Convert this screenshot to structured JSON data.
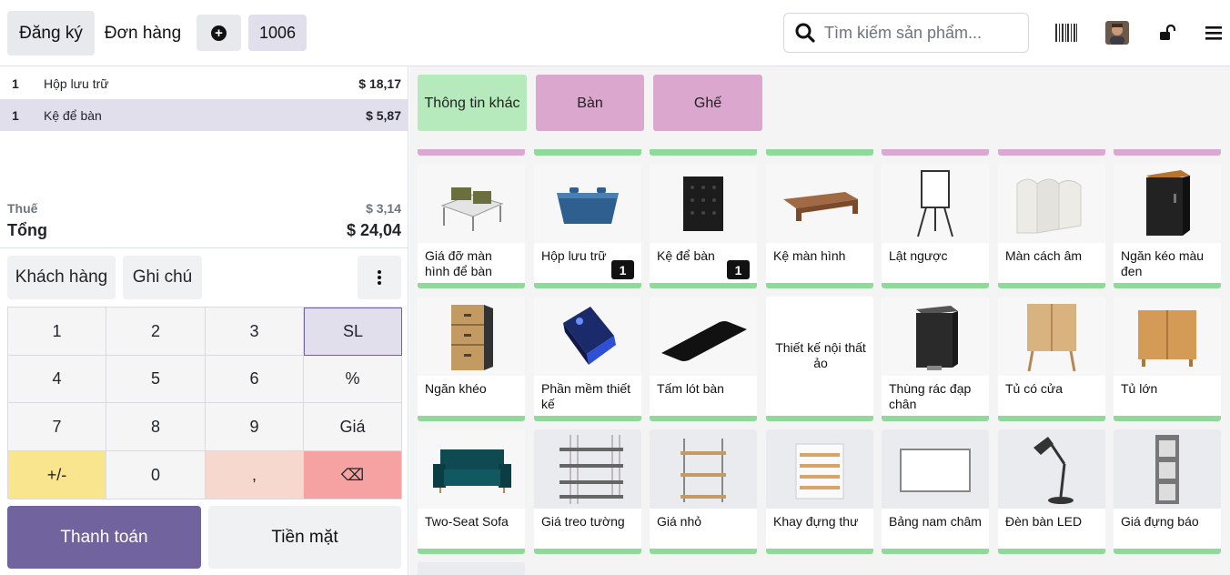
{
  "topbar": {
    "register": "Đăng ký",
    "orders": "Đơn hàng",
    "order_number": "1006",
    "search_placeholder": "Tìm kiếm sản phẩm..."
  },
  "order_lines": [
    {
      "qty": "1",
      "name": "Hộp lưu trữ",
      "price": "$ 18,17"
    },
    {
      "qty": "1",
      "name": "Kệ để bàn",
      "price": "$ 5,87"
    }
  ],
  "totals": {
    "tax_label": "Thuế",
    "tax_value": "$ 3,14",
    "total_label": "Tổng",
    "total_value": "$ 24,04"
  },
  "actions": {
    "customer": "Khách hàng",
    "note": "Ghi chú"
  },
  "numpad": [
    [
      "1",
      "2",
      "3",
      "SL"
    ],
    [
      "4",
      "5",
      "6",
      "%"
    ],
    [
      "7",
      "8",
      "9",
      "Giá"
    ],
    [
      "+/-",
      "0",
      ",",
      "⌫"
    ]
  ],
  "payment": {
    "pay": "Thanh toán",
    "cash": "Tiền mặt"
  },
  "categories": [
    {
      "label": "Thông tin khác",
      "color": "#b6eabc"
    },
    {
      "label": "Bàn",
      "color": "#dba7cf"
    },
    {
      "label": "Ghế",
      "color": "#dba7cf"
    }
  ],
  "products": [
    {
      "name": "Giá đỡ màn hình để bàn",
      "icon": "desk-organizer-icon"
    },
    {
      "name": "Hộp lưu trữ",
      "badge": "1",
      "icon": "storage-box-icon"
    },
    {
      "name": "Kệ để bàn",
      "badge": "1",
      "icon": "desk-bin-icon"
    },
    {
      "name": "Kệ màn hình",
      "icon": "monitor-stand-icon"
    },
    {
      "name": "Lật ngược",
      "icon": "flipchart-icon"
    },
    {
      "name": "Màn cách âm",
      "icon": "acoustic-screen-icon"
    },
    {
      "name": "Ngăn kéo màu đen",
      "icon": "black-drawer-icon"
    },
    {
      "name": "Ngăn khéo",
      "icon": "drawer-cabinet-icon"
    },
    {
      "name": "Phần mềm thiết kế",
      "icon": "software-box-icon"
    },
    {
      "name": "Tấm lót bàn",
      "icon": "desk-pad-icon"
    },
    {
      "name": "Thiết kế nội thất ảo",
      "icon": ""
    },
    {
      "name": "Thùng rác đạp chân",
      "icon": "pedal-bin-icon"
    },
    {
      "name": "Tủ có cửa",
      "icon": "cabinet-door-icon"
    },
    {
      "name": "Tủ lớn",
      "icon": "large-cabinet-icon"
    },
    {
      "name": "Two-Seat Sofa",
      "icon": "sofa-icon"
    },
    {
      "name": "Giá treo tường",
      "icon": "wall-shelf-icon"
    },
    {
      "name": "Giá nhỏ",
      "icon": "small-shelf-icon"
    },
    {
      "name": "Khay đựng thư",
      "icon": "letter-tray-icon"
    },
    {
      "name": "Bảng nam châm",
      "icon": "whiteboard-icon"
    },
    {
      "name": "Đèn bàn LED",
      "icon": "desk-lamp-icon"
    },
    {
      "name": "Giá đựng báo",
      "icon": "magazine-rack-icon"
    }
  ],
  "colors": {
    "pay_button": "#71639e",
    "selected_line": "#e1dfec",
    "product_bar": "#8fd99a",
    "category_pink": "#dba7cf",
    "category_green": "#b6eabc"
  }
}
